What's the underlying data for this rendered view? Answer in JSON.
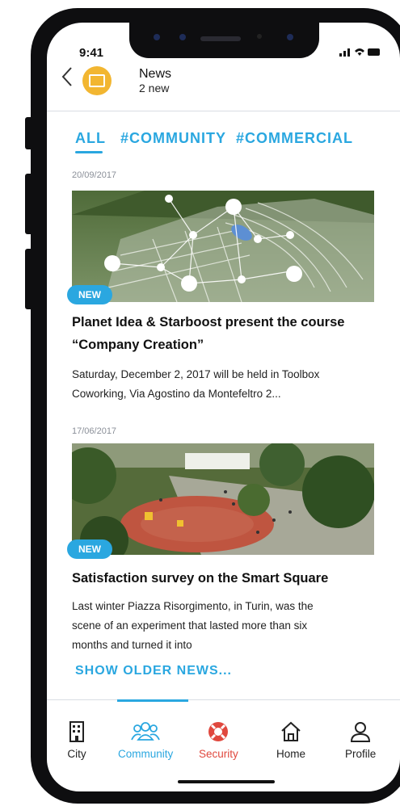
{
  "status_bar": {
    "time": "9:41",
    "icons": "signal-wifi-battery"
  },
  "header": {
    "title": "News",
    "subtitle": "2 new",
    "back_icon": "chevron-left-icon",
    "avatar_icon": "newspaper-icon",
    "avatar_color": "#f2b631"
  },
  "tabs": [
    {
      "label": "ALL",
      "active": true
    },
    {
      "label": "#COMMUNITY",
      "active": false
    },
    {
      "label": "#COMMERCIAL",
      "active": false
    }
  ],
  "news": [
    {
      "date": "20/09/2017",
      "badge": "NEW",
      "title_line1": "Planet Idea & Starboost present the course",
      "title_line2": "“Company Creation”",
      "body_line1": "Saturday, December 2, 2017 will be held in Toolbox",
      "body_line2": "Coworking, Via Agostino da Montefeltro 2..."
    },
    {
      "date": "17/06/2017",
      "badge": "NEW",
      "title_line1": "Satisfaction survey on the Smart Square",
      "body_line1": "Last winter Piazza Risorgimento, in Turin, was the",
      "body_line2": "scene of an experiment that lasted more than six",
      "body_line3": "months and turned it into"
    }
  ],
  "show_older": "SHOW OLDER NEWS...",
  "bottom_nav": [
    {
      "label": "City",
      "icon": "building-icon",
      "color": "#222222"
    },
    {
      "label": "Community",
      "icon": "people-icon",
      "color": "#2aa7e0"
    },
    {
      "label": "Security",
      "icon": "lifebuoy-icon",
      "color": "#e0483e"
    },
    {
      "label": "Home",
      "icon": "house-icon",
      "color": "#222222"
    },
    {
      "label": "Profile",
      "icon": "person-icon",
      "color": "#222222"
    }
  ],
  "colors": {
    "accent": "#2aa7e0",
    "security": "#e0483e"
  }
}
